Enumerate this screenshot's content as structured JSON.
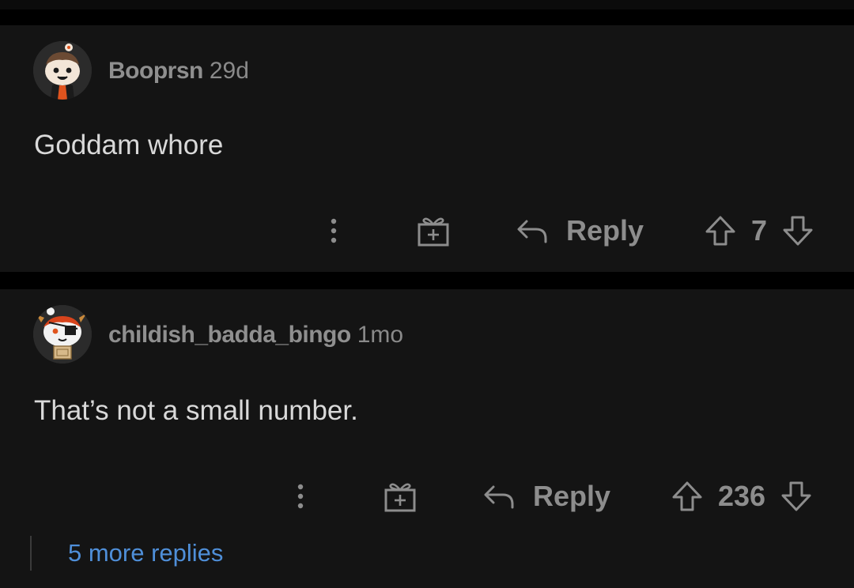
{
  "comments": [
    {
      "username": "Booprsn",
      "age": "29d",
      "body": "Goddam whore",
      "reply_label": "Reply",
      "score": "7"
    },
    {
      "username": "childish_badda_bingo",
      "age": "1mo",
      "body": "That’s not a small number.",
      "reply_label": "Reply",
      "score": "236"
    }
  ],
  "more_replies": "5 more replies",
  "icons": {
    "more": "more-vertical-icon",
    "award": "gift-icon",
    "reply": "reply-arrow-icon",
    "upvote": "upvote-arrow-icon",
    "downvote": "downvote-arrow-icon"
  },
  "colors": {
    "background": "#000000",
    "card": "#141414",
    "text": "#d9d9d9",
    "muted": "#8d8d8d",
    "link": "#4f8fd9"
  }
}
